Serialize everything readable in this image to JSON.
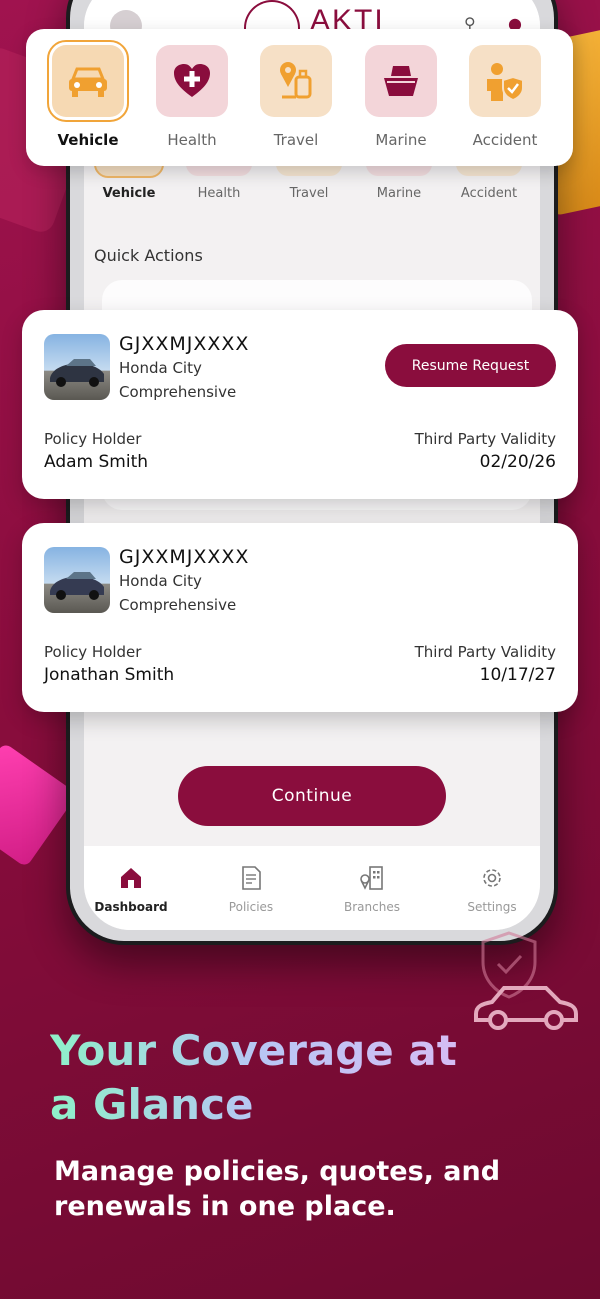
{
  "app": {
    "logo_text": "AKTI"
  },
  "categories": [
    {
      "label": "Vehicle",
      "icon": "car-icon",
      "bg": "#f6d9b3",
      "active": true
    },
    {
      "label": "Health",
      "icon": "heart-plus-icon",
      "bg": "#f3d5d9",
      "active": false
    },
    {
      "label": "Travel",
      "icon": "luggage-icon",
      "bg": "#f6e0c6",
      "active": false
    },
    {
      "label": "Marine",
      "icon": "ship-icon",
      "bg": "#f3d5d9",
      "active": false
    },
    {
      "label": "Accident",
      "icon": "person-shield-icon",
      "bg": "#f6e0c6",
      "active": false
    }
  ],
  "quick_actions": {
    "title": "Quick Actions"
  },
  "policies": [
    {
      "plate": "GJXXMJXXXX",
      "model": "Honda City",
      "coverage": "Comprehensive",
      "holder_label": "Policy Holder",
      "holder": "Adam Smith",
      "validity_label": "Third Party Validity",
      "validity": "02/20/26",
      "action": "Resume Request"
    },
    {
      "plate": "GJXXMJXXXX",
      "model": "Honda City",
      "coverage": "Comprehensive",
      "holder_label": "Policy Holder",
      "holder": "Jonathan Smith",
      "validity_label": "Third Party Validity",
      "validity": "10/17/27"
    }
  ],
  "continue_label": "Continue",
  "tabs": [
    {
      "label": "Dashboard",
      "icon": "home-icon",
      "active": true
    },
    {
      "label": "Policies",
      "icon": "document-icon",
      "active": false
    },
    {
      "label": "Branches",
      "icon": "building-location-icon",
      "active": false
    },
    {
      "label": "Settings",
      "icon": "gear-icon",
      "active": false
    }
  ],
  "promo": {
    "headline_1": "Your Coverage at",
    "headline_2": "a Glance",
    "subline_1": "Manage policies, quotes, and",
    "subline_2": "renewals in one place."
  },
  "colors": {
    "brand": "#8a0d3d",
    "accent": "#f1a53a",
    "icon_orange": "#f0a030"
  }
}
